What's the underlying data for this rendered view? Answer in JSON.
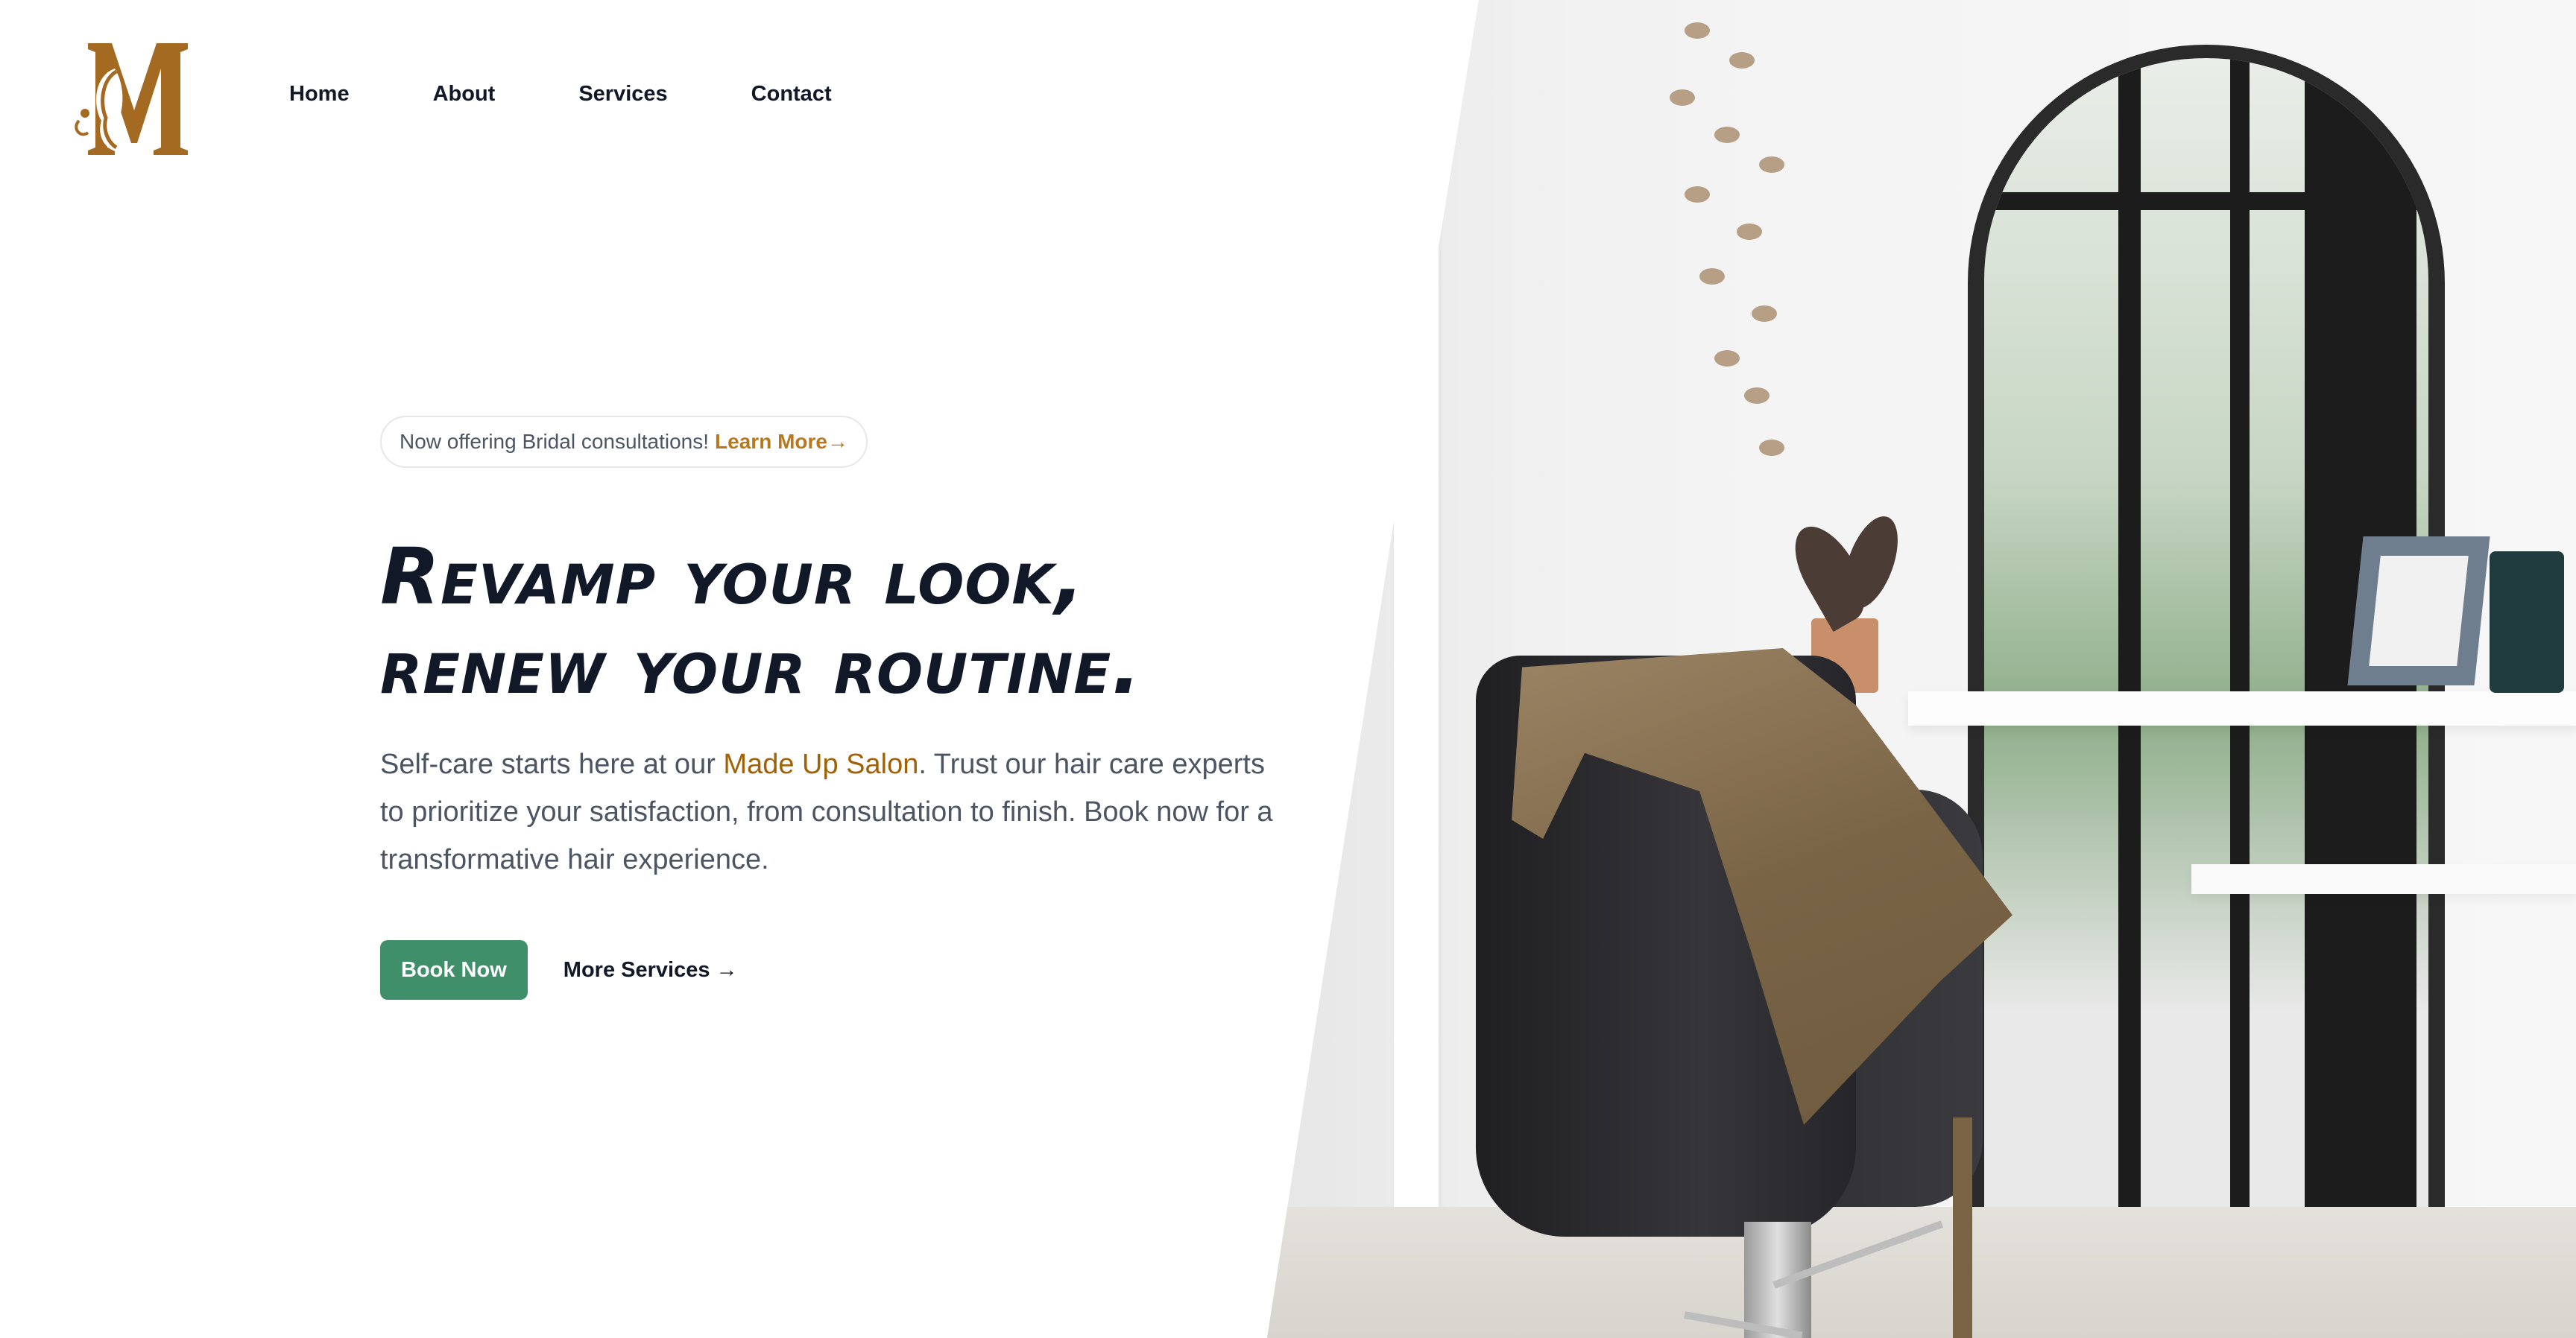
{
  "brand": {
    "logo_letter": "M",
    "color": "#a56a22"
  },
  "nav": {
    "items": [
      {
        "label": "Home"
      },
      {
        "label": "About"
      },
      {
        "label": "Services"
      },
      {
        "label": "Contact"
      }
    ]
  },
  "announcement": {
    "text": "Now offering Bridal consultations!",
    "link_label": "Learn More→"
  },
  "hero": {
    "headline_line1": "Revamp your look,",
    "headline_line2": "renew your routine.",
    "lede_prefix": "Self-care starts here at our ",
    "lede_brand": "Made Up Salon",
    "lede_suffix": ". Trust our hair care experts to prioritize your satisfaction, from consultation to finish. Book now for a transformative hair experience.",
    "primary_cta": "Book Now",
    "secondary_cta": "More Services →"
  },
  "colors": {
    "accent_green": "#3f8f6b",
    "accent_gold": "#b7791f",
    "text_dark": "#111827",
    "text_muted": "#4b5563"
  },
  "images": {
    "hero_photo": "salon-chair-mirror-photo"
  }
}
